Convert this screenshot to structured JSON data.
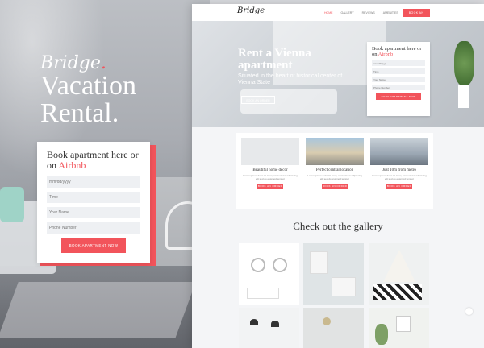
{
  "promo": {
    "brand": "Bridge",
    "brand_dot": ".",
    "title_line1": "Vacation",
    "title_line2": "Rental."
  },
  "left_booking": {
    "heading_prefix": "Book apartment here or on ",
    "heading_accent": "Airbnb",
    "fields": [
      "mm/dd/yyyy",
      "Time",
      "Your Name",
      "Phone Number"
    ],
    "button": "BOOK APARTMENT NOW"
  },
  "site": {
    "logo": "Bridge",
    "nav": [
      "HOME",
      "GALLERY",
      "REVIEWS",
      "AMENITIES"
    ],
    "nav_button": "BOOK AN ORDER",
    "hero": {
      "title_line1": "Rent a Vienna",
      "title_line2": "apartment",
      "subtitle": "Situated in the heart of historical center of Vienna State",
      "button": "BOOK AN ORDER"
    },
    "booking": {
      "heading_prefix": "Book apartment here or on ",
      "heading_accent": "Airbnb",
      "fields": [
        "mm/dd/yyyy",
        "Time",
        "Your Name",
        "Phone Number"
      ],
      "button": "BOOK APARTMENT NOW"
    },
    "features": [
      {
        "title": "Beautiful home decor",
        "text": "Lorem ipsum dolor sit amet, consectetur adipiscing elit sed do eiusmod tempor",
        "button": "BOOK AN ORDER",
        "color": "#e7e9eb"
      },
      {
        "title": "Perfect central location",
        "text": "Lorem ipsum dolor sit amet, consectetur adipiscing elit sed do eiusmod tempor",
        "button": "BOOK AN ORDER",
        "color": "#c7b99c"
      },
      {
        "title": "Just 10m from metro",
        "text": "Lorem ipsum dolor sit amet, consectetur adipiscing elit sed do eiusmod tempor",
        "button": "BOOK AN ORDER",
        "color": "#b7c2cc"
      }
    ],
    "gallery_title": "Check out the gallery",
    "scroll_icon": "↑"
  },
  "colors": {
    "accent": "#f2545b",
    "page_bg": "#f4f5f7"
  }
}
